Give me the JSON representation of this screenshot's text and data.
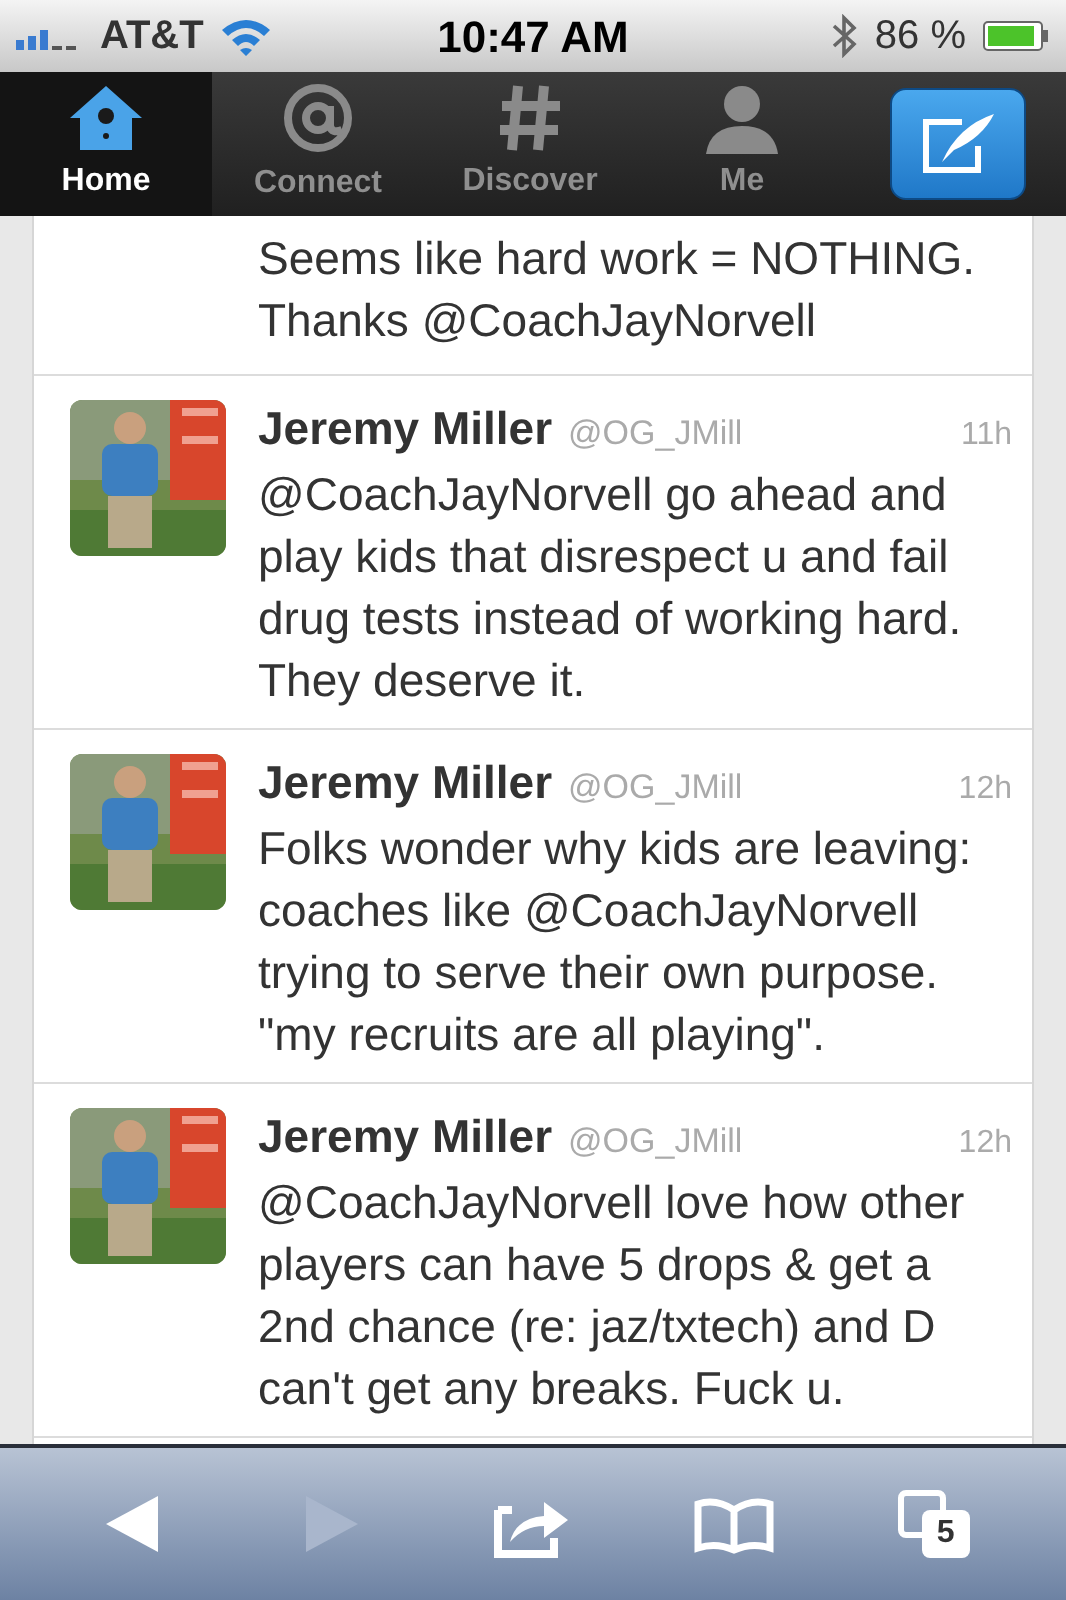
{
  "status_bar": {
    "carrier": "AT&T",
    "time": "10:47 AM",
    "battery": "86 %"
  },
  "tabs": [
    {
      "label": "Home",
      "kind": "home",
      "selected": true
    },
    {
      "label": "Connect",
      "kind": "connect",
      "selected": false
    },
    {
      "label": "Discover",
      "kind": "discover",
      "selected": false
    },
    {
      "label": "Me",
      "kind": "me",
      "selected": false
    }
  ],
  "partial_tweet": {
    "text": "Seems like hard work = NOTHING. Thanks @CoachJayNorvell"
  },
  "tweets": [
    {
      "name": "Jeremy Miller",
      "handle": "@OG_JMill",
      "time": "11h",
      "text": "@CoachJayNorvell go ahead and play kids that disrespect u and fail drug tests instead of working hard. They deserve it."
    },
    {
      "name": "Jeremy Miller",
      "handle": "@OG_JMill",
      "time": "12h",
      "text": "Folks wonder why kids are leaving: coaches like @CoachJayNorvell trying to serve their own purpose. \"my recruits are all playing\"."
    },
    {
      "name": "Jeremy Miller",
      "handle": "@OG_JMill",
      "time": "12h",
      "text": "@CoachJayNorvell love how other players can have 5 drops & get a 2nd chance (re: jaz/txtech) and D can't get any breaks. Fuck u."
    }
  ],
  "toolbar": [
    {
      "kind": "back",
      "disabled": false
    },
    {
      "kind": "forward",
      "disabled": true
    },
    {
      "kind": "share",
      "disabled": false
    },
    {
      "kind": "bookmarks",
      "disabled": false
    },
    {
      "kind": "tabs",
      "disabled": false,
      "count": "5"
    }
  ]
}
